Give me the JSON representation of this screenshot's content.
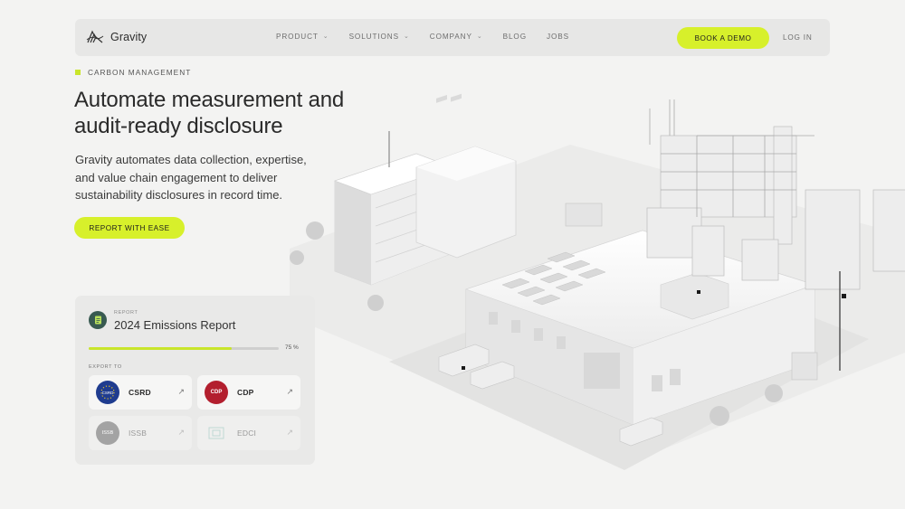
{
  "nav": {
    "brand": "Gravity",
    "menu": [
      {
        "label": "PRODUCT",
        "has_dropdown": true
      },
      {
        "label": "SOLUTIONS",
        "has_dropdown": true
      },
      {
        "label": "COMPANY",
        "has_dropdown": true
      },
      {
        "label": "BLOG",
        "has_dropdown": false
      },
      {
        "label": "JOBS",
        "has_dropdown": false
      }
    ],
    "cta": "BOOK A DEMO",
    "login": "LOG IN"
  },
  "hero": {
    "eyebrow": "CARBON MANAGEMENT",
    "headline": "Automate measurement and audit-ready disclosure",
    "subtext": "Gravity automates data collection, expertise, and value chain engagement to deliver sustainability disclosures in record time.",
    "cta": "REPORT WITH EASE"
  },
  "card": {
    "kicker": "REPORT",
    "title": "2024 Emissions Report",
    "progress": 0.75,
    "progress_label": "75 %",
    "export_label": "EXPORT TO",
    "targets": [
      {
        "name": "CSRD",
        "badge": "CSRD",
        "badge_color": "#1f3c8f",
        "active": true
      },
      {
        "name": "CDP",
        "badge": "CDP",
        "badge_color": "#b31f2e",
        "active": true
      },
      {
        "name": "ISSB",
        "badge": "ISSB",
        "badge_color": "#9a9a9a",
        "active": false
      },
      {
        "name": "EDCI",
        "badge": "",
        "badge_color": "#bfd8d4",
        "active": false
      }
    ]
  },
  "colors": {
    "accent": "#d7f02b",
    "background": "#f3f3f2",
    "report_icon": "#385a51"
  },
  "icons": {
    "logo": "gravity-wave-logo-icon",
    "dropdown": "chevron-down-icon",
    "report": "document-icon",
    "tile_arrow": "arrow-up-right-icon"
  }
}
